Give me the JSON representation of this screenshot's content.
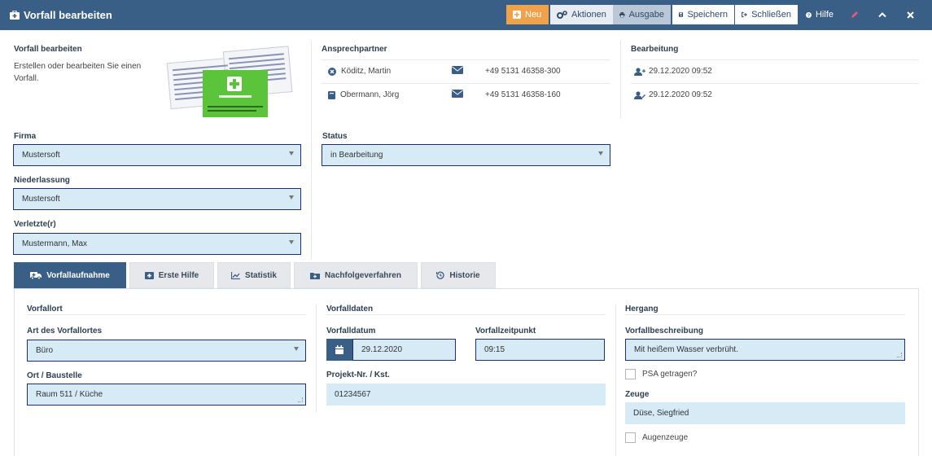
{
  "window": {
    "title": "Vorfall bearbeiten"
  },
  "toolbar": {
    "neu": "Neu",
    "aktionen": "Aktionen",
    "ausgabe": "Ausgabe",
    "speichern": "Speichern",
    "schliessen": "Schließen",
    "hilfe": "Hilfe"
  },
  "intro": {
    "heading": "Vorfall bearbeiten",
    "description": "Erstellen oder bearbeiten Sie einen Vorfall."
  },
  "ansprechpartner": {
    "heading": "Ansprechpartner",
    "contacts": [
      {
        "name": "Köditz, Martin",
        "phone": "+49 5131 46358-300",
        "icon": "times-circle-icon"
      },
      {
        "name": "Obermann, Jörg",
        "phone": "+49 5131 46358-160",
        "icon": "book-icon"
      }
    ]
  },
  "bearbeitung": {
    "heading": "Bearbeitung",
    "entries": [
      {
        "date": "29.12.2020 09:52",
        "icon": "user-plus-icon"
      },
      {
        "date": "29.12.2020 09:52",
        "icon": "user-edit-icon"
      }
    ]
  },
  "form": {
    "firma_label": "Firma",
    "firma_value": "Mustersoft",
    "niederlassung_label": "Niederlassung",
    "niederlassung_value": "Mustersoft",
    "verletzte_label": "Verletzte(r)",
    "verletzte_value": "Mustermann, Max",
    "status_label": "Status",
    "status_value": "in Bearbeitung"
  },
  "tabs": [
    {
      "label": "Vorfallaufnahme",
      "icon": "ambulance-icon",
      "active": true
    },
    {
      "label": "Erste Hilfe",
      "icon": "first-aid-icon",
      "active": false
    },
    {
      "label": "Statistik",
      "icon": "chart-line-icon",
      "active": false
    },
    {
      "label": "Nachfolgeverfahren",
      "icon": "folder-plus-icon",
      "active": false
    },
    {
      "label": "Historie",
      "icon": "history-icon",
      "active": false
    }
  ],
  "vorfallort": {
    "heading": "Vorfallort",
    "art_label": "Art des Vorfallortes",
    "art_value": "Büro",
    "ort_label": "Ort / Baustelle",
    "ort_value": "Raum 511 / Küche"
  },
  "vorfalldaten": {
    "heading": "Vorfalldaten",
    "datum_label": "Vorfalldatum",
    "datum_value": "29.12.2020",
    "zeit_label": "Vorfallzeitpunkt",
    "zeit_value": "09:15",
    "projekt_label": "Projekt-Nr. / Kst.",
    "projekt_value": "01234567"
  },
  "hergang": {
    "heading": "Hergang",
    "beschreibung_label": "Vorfallbeschreibung",
    "beschreibung_value": "Mit heißem Wasser verbrüht.",
    "psa_label": "PSA getragen?",
    "zeuge_label": "Zeuge",
    "zeuge_value": "Düse, Siegfried",
    "augenzeuge_label": "Augenzeuge"
  },
  "colors": {
    "header": "#3a5f86",
    "accent_orange": "#f0a24a",
    "field_bg": "#d6ebf5",
    "field_border": "#1d2e72",
    "first_aid_green": "#5cc43a"
  }
}
